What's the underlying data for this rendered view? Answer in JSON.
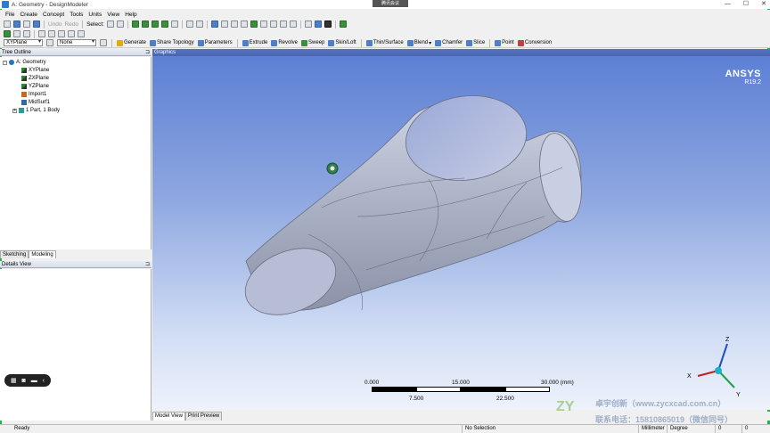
{
  "window": {
    "title": "A: Geometry - DesignModeler",
    "meeting_label": "腾讯会议"
  },
  "menu": [
    "File",
    "Create",
    "Concept",
    "Tools",
    "Units",
    "View",
    "Help"
  ],
  "toolbar1": {
    "undo": "Undo",
    "redo": "Redo",
    "select": "Select:"
  },
  "toolbar3": {
    "plane_combo": "XYPlane",
    "sketch_combo": "None",
    "commands": [
      "Generate",
      "Share Topology",
      "Parameters",
      "Extrude",
      "Revolve",
      "Sweep",
      "Skin/Loft",
      "Thin/Surface",
      "Blend",
      "Chamfer",
      "Slice",
      "Point",
      "Conversion"
    ]
  },
  "tree": {
    "header": "Tree Outline",
    "root": "A: Geometry",
    "items": [
      "XYPlane",
      "ZXPlane",
      "YZPlane",
      "Import1",
      "MidSurf1",
      "1 Part, 1 Body"
    ]
  },
  "left_tabs": [
    "Sketching",
    "Modeling"
  ],
  "details": {
    "header": "Details View"
  },
  "graphics": {
    "header": "Graphics",
    "brand": "ANSYS",
    "version": "R19.2"
  },
  "scale": {
    "top_labels": [
      "0.000",
      "15.000",
      "30.000 (mm)"
    ],
    "bottom_labels": [
      "7.500",
      "22.500"
    ]
  },
  "triad": {
    "x": "X",
    "y": "Y",
    "z": "Z"
  },
  "view_tabs": [
    "Model View",
    "Print Preview"
  ],
  "watermark": {
    "line1": "卓宇创新（www.zycxcad.com.cn）",
    "line2": "联系电话：15810865019（微信同号）"
  },
  "status": {
    "ready": "Ready",
    "selection": "No Selection",
    "unit": "Millimeter",
    "angle": "Degree",
    "v1": "0",
    "v2": "0"
  }
}
